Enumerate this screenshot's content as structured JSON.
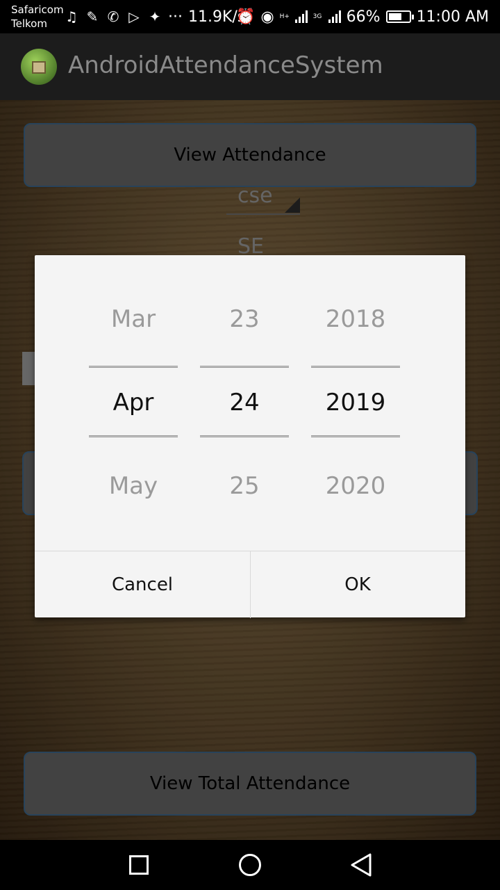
{
  "status_bar": {
    "carrier1": "Safaricom",
    "carrier2": "Telkom",
    "speed": "11.9K/s",
    "network1": "H+",
    "network2": "3G",
    "battery": "66%",
    "battery_level": 0.66,
    "time": "11:00 AM",
    "dots": "···"
  },
  "app_bar": {
    "title": "AndroidAttendanceSystem"
  },
  "main": {
    "view_attendance_label": "View Attendance",
    "branch_spinner": "cse",
    "year_spinner": "SE",
    "view_total_label": "View Total Attendance"
  },
  "date_picker": {
    "month": {
      "prev": "Mar",
      "selected": "Apr",
      "next": "May"
    },
    "day": {
      "prev": "23",
      "selected": "24",
      "next": "25"
    },
    "year": {
      "prev": "2018",
      "selected": "2019",
      "next": "2020"
    },
    "cancel_label": "Cancel",
    "ok_label": "OK"
  }
}
